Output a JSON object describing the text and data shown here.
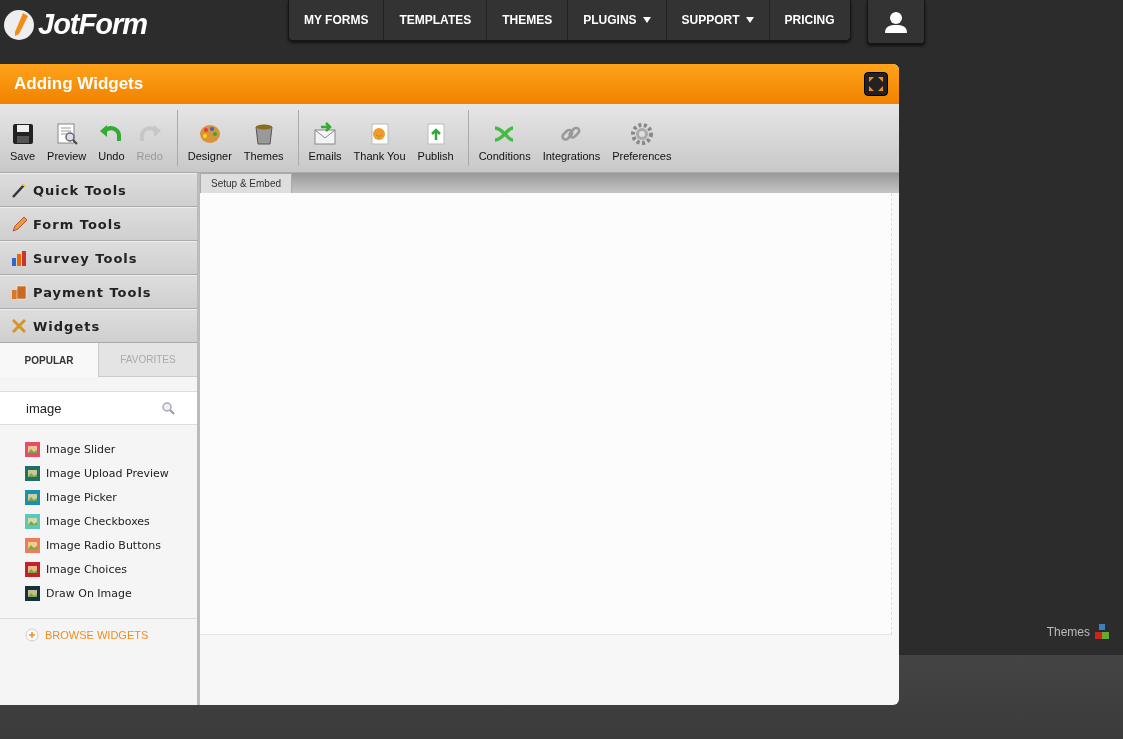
{
  "header": {
    "logo": "JotForm",
    "nav": [
      {
        "label": "MY FORMS",
        "has_menu": false
      },
      {
        "label": "TEMPLATES",
        "has_menu": false
      },
      {
        "label": "THEMES",
        "has_menu": false
      },
      {
        "label": "PLUGINS",
        "has_menu": true
      },
      {
        "label": "SUPPORT",
        "has_menu": true
      },
      {
        "label": "PRICING",
        "has_menu": false
      }
    ]
  },
  "window": {
    "title": "Adding Widgets"
  },
  "toolbar": [
    [
      {
        "kind": "save",
        "label": "Save",
        "disabled": false
      },
      {
        "kind": "preview",
        "label": "Preview",
        "disabled": false
      },
      {
        "kind": "undo",
        "label": "Undo",
        "disabled": false
      },
      {
        "kind": "redo",
        "label": "Redo",
        "disabled": true
      }
    ],
    [
      {
        "kind": "designer",
        "label": "Designer",
        "disabled": false
      },
      {
        "kind": "themes",
        "label": "Themes",
        "disabled": false
      }
    ],
    [
      {
        "kind": "emails",
        "label": "Emails",
        "disabled": false
      },
      {
        "kind": "thankyou",
        "label": "Thank You",
        "disabled": false
      },
      {
        "kind": "publish",
        "label": "Publish",
        "disabled": false
      }
    ],
    [
      {
        "kind": "conditions",
        "label": "Conditions",
        "disabled": false
      },
      {
        "kind": "integrations",
        "label": "Integrations",
        "disabled": false
      },
      {
        "kind": "preferences",
        "label": "Preferences",
        "disabled": false
      }
    ]
  ],
  "sidebar": {
    "sections": [
      {
        "kind": "quick",
        "label": "Quick Tools",
        "expanded": false
      },
      {
        "kind": "form",
        "label": "Form Tools",
        "expanded": false
      },
      {
        "kind": "survey",
        "label": "Survey Tools",
        "expanded": false
      },
      {
        "kind": "payment",
        "label": "Payment Tools",
        "expanded": false
      },
      {
        "kind": "widgets",
        "label": "Widgets",
        "expanded": true
      }
    ],
    "tabs": [
      {
        "label": "POPULAR",
        "selected": true
      },
      {
        "label": "FAVORITES",
        "selected": false
      }
    ],
    "search": {
      "value": "image"
    },
    "widgets": [
      {
        "label": "Image Slider",
        "color": "#e84c6a"
      },
      {
        "label": "Image Upload Preview",
        "color": "#1f6f6a"
      },
      {
        "label": "Image Picker",
        "color": "#1b8fb0"
      },
      {
        "label": "Image Checkboxes",
        "color": "#5bc8c0"
      },
      {
        "label": "Image Radio Buttons",
        "color": "#f07a5c"
      },
      {
        "label": "Image Choices",
        "color": "#c8202a"
      },
      {
        "label": "Draw On Image",
        "color": "#163040"
      }
    ],
    "browse": "BROWSE WIDGETS"
  },
  "content": {
    "tabs": [
      {
        "label": "Setup & Embed",
        "selected": true
      }
    ]
  },
  "footer": {
    "themes_link": "Themes"
  }
}
